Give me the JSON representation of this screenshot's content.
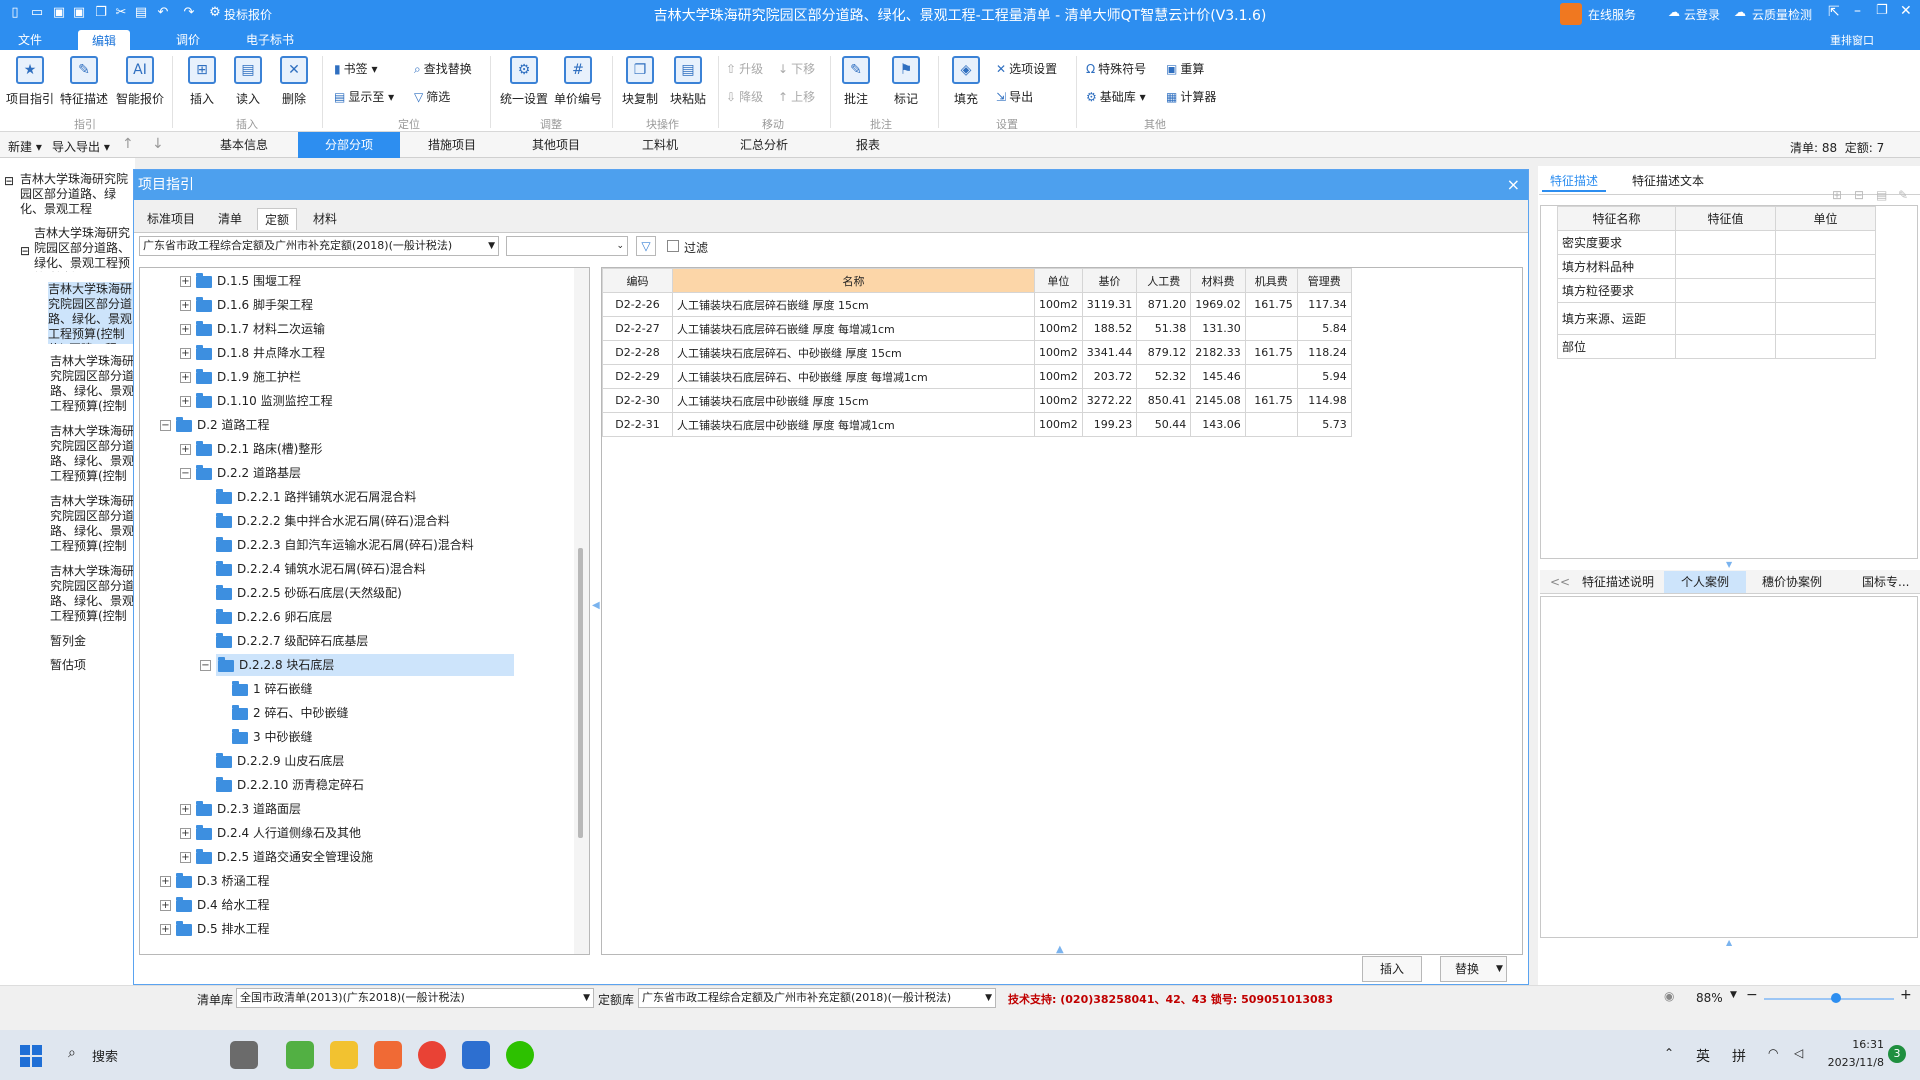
{
  "window": {
    "title": "吉林大学珠海研究院园区部分道路、绿化、景观工程-工程量清单 - 清单大师QT智慧云计价(V3.1.6)",
    "quick_bid": "投标报价",
    "online_service": "在线服务",
    "cloud_login": "云登录",
    "cloud_quality": "云质量检测",
    "rearrange_window": "重排窗口"
  },
  "menu": [
    "文件",
    "编辑",
    "调价",
    "电子标书"
  ],
  "menu_active": "编辑",
  "ribbon": {
    "big_buttons": [
      "项目指引",
      "特征描述",
      "智能报价",
      "插入",
      "读入",
      "删除",
      "统一设置",
      "单价编号",
      "块复制",
      "块粘贴",
      "批注",
      "标记",
      "填充"
    ],
    "small_buttons": {
      "bookmark": "书签",
      "show_to": "显示至",
      "find_replace": "查找替换",
      "filter": "筛选",
      "upgrade": "升级",
      "downgrade": "降级",
      "move_down": "下移",
      "move_up": "上移",
      "options": "选项设置",
      "export": "导出",
      "special_symbol": "特殊符号",
      "base_lib": "基础库",
      "recalc": "重算",
      "calculator": "计算器"
    },
    "groups": [
      "指引",
      "插入",
      "定位",
      "调整",
      "块操作",
      "移动",
      "批注",
      "设置",
      "其他"
    ]
  },
  "toolbar": {
    "new": "新建",
    "import_export": "导入导出",
    "page_tabs": [
      "基本信息",
      "分部分项",
      "措施项目",
      "其他项目",
      "工料机",
      "汇总分析",
      "报表"
    ],
    "active_tab": "分部分项",
    "count_qd_label": "清单:",
    "count_qd": "88",
    "count_de_label": "定额:",
    "count_de": "7"
  },
  "left_tree": [
    "吉林大学珠海研究院园区部分道路、绿化、景观工程",
    "吉林大学珠海研究院园区部分道路、绿化、景观工程预算(控制价)",
    "吉林大学珠海研究院园区部分道路、绿化、景观工程预算(控制价)-园建工程",
    "吉林大学珠海研究院园区部分道路、绿化、景观工程预算(控制价)-绿化工程",
    "吉林大学珠海研究院园区部分道路、绿化、景观工程预算(控制价)-给水工程",
    "吉林大学珠海研究院园区部分道路、绿化、景观工程预算(控制价)-排水工程",
    "吉林大学珠海研究院园区部分道路、绿化、景观工程预算(控制价)-照明工程",
    "暂列金",
    "暂估项"
  ],
  "dialog": {
    "title": "项目指引",
    "close": "×",
    "tabs": [
      "标准项目",
      "清单",
      "定额",
      "材料"
    ],
    "active_tab": "定额",
    "quota_lib": "广东省市政工程综合定额及广州市补充定额(2018)(一般计税法)",
    "filter_label": "过滤",
    "tree": [
      {
        "level": 1,
        "label": "D.1.5 围堰工程",
        "exp": "+"
      },
      {
        "level": 1,
        "label": "D.1.6 脚手架工程",
        "exp": "+"
      },
      {
        "level": 1,
        "label": "D.1.7 材料二次运输",
        "exp": "+"
      },
      {
        "level": 1,
        "label": "D.1.8 井点降水工程",
        "exp": "+"
      },
      {
        "level": 1,
        "label": "D.1.9 施工护栏",
        "exp": "+"
      },
      {
        "level": 1,
        "label": "D.1.10 监测监控工程",
        "exp": "+"
      },
      {
        "level": 0,
        "label": "D.2 道路工程",
        "exp": "−"
      },
      {
        "level": 1,
        "label": "D.2.1 路床(槽)整形",
        "exp": "+"
      },
      {
        "level": 1,
        "label": "D.2.2 道路基层",
        "exp": "−"
      },
      {
        "level": 2,
        "label": "D.2.2.1 路拌铺筑水泥石屑混合料",
        "exp": ""
      },
      {
        "level": 2,
        "label": "D.2.2.2 集中拌合水泥石屑(碎石)混合料",
        "exp": ""
      },
      {
        "level": 2,
        "label": "D.2.2.3 自卸汽车运输水泥石屑(碎石)混合料",
        "exp": ""
      },
      {
        "level": 2,
        "label": "D.2.2.4 铺筑水泥石屑(碎石)混合料",
        "exp": ""
      },
      {
        "level": 2,
        "label": "D.2.2.5 砂砾石底层(天然级配)",
        "exp": ""
      },
      {
        "level": 2,
        "label": "D.2.2.6 卵石底层",
        "exp": ""
      },
      {
        "level": 2,
        "label": "D.2.2.7 级配碎石底基层",
        "exp": ""
      },
      {
        "level": 2,
        "label": "D.2.2.8 块石底层",
        "exp": "−",
        "selected": true
      },
      {
        "level": 3,
        "label": "1 碎石嵌缝",
        "exp": ""
      },
      {
        "level": 3,
        "label": "2 碎石、中砂嵌缝",
        "exp": ""
      },
      {
        "level": 3,
        "label": "3 中砂嵌缝",
        "exp": ""
      },
      {
        "level": 2,
        "label": "D.2.2.9 山皮石底层",
        "exp": ""
      },
      {
        "level": 2,
        "label": "D.2.2.10 沥青稳定碎石",
        "exp": ""
      },
      {
        "level": 1,
        "label": "D.2.3 道路面层",
        "exp": "+"
      },
      {
        "level": 1,
        "label": "D.2.4 人行道侧缘石及其他",
        "exp": "+"
      },
      {
        "level": 1,
        "label": "D.2.5 道路交通安全管理设施",
        "exp": "+"
      },
      {
        "level": 0,
        "label": "D.3 桥涵工程",
        "exp": "+"
      },
      {
        "level": 0,
        "label": "D.4 给水工程",
        "exp": "+"
      },
      {
        "level": 0,
        "label": "D.5 排水工程",
        "exp": "+"
      }
    ],
    "columns": [
      "编码",
      "名称",
      "单位",
      "基价",
      "人工费",
      "材料费",
      "机具费",
      "管理费"
    ],
    "rows": [
      [
        "D2-2-26",
        "人工铺装块石底层碎石嵌缝 厚度 15cm",
        "100m2",
        "3119.31",
        "871.20",
        "1969.02",
        "161.75",
        "117.34"
      ],
      [
        "D2-2-27",
        "人工铺装块石底层碎石嵌缝 厚度 每增减1cm",
        "100m2",
        "188.52",
        "51.38",
        "131.30",
        "",
        "5.84"
      ],
      [
        "D2-2-28",
        "人工铺装块石底层碎石、中砂嵌缝 厚度 15cm",
        "100m2",
        "3341.44",
        "879.12",
        "2182.33",
        "161.75",
        "118.24"
      ],
      [
        "D2-2-29",
        "人工铺装块石底层碎石、中砂嵌缝 厚度 每增减1cm",
        "100m2",
        "203.72",
        "52.32",
        "145.46",
        "",
        "5.94"
      ],
      [
        "D2-2-30",
        "人工铺装块石底层中砂嵌缝 厚度 15cm",
        "100m2",
        "3272.22",
        "850.41",
        "2145.08",
        "161.75",
        "114.98"
      ],
      [
        "D2-2-31",
        "人工铺装块石底层中砂嵌缝 厚度 每增减1cm",
        "100m2",
        "199.23",
        "50.44",
        "143.06",
        "",
        "5.73"
      ]
    ],
    "insert": "插入",
    "replace": "替换"
  },
  "right_panel": {
    "tabs": [
      "特征描述",
      "特征描述文本"
    ],
    "columns": [
      "特征名称",
      "特征值",
      "单位"
    ],
    "features": [
      "密实度要求",
      "填方材料品种",
      "填方粒径要求",
      "填方来源、运距",
      "部位"
    ],
    "bottom_nav": "<<",
    "bottom_tabs": [
      "特征描述说明",
      "个人案例",
      "穗价协案例",
      "国标专..."
    ],
    "bottom_active": "个人案例"
  },
  "status": {
    "qd_lib_label": "清单库",
    "qd_lib": "全国市政清单(2013)(广东2018)(一般计税法)",
    "de_lib_label": "定额库",
    "de_lib": "广东省市政工程综合定额及广州市补充定额(2018)(一般计税法)",
    "support": "技术支持: (020)38258041、42、43 锁号: 509051013083",
    "zoom": "88%"
  },
  "taskbar": {
    "search": "搜索",
    "ime1": "英",
    "ime2": "拼",
    "time": "16:31",
    "date": "2023/11/8",
    "badge": "3"
  },
  "colors": {
    "accent": "#2d8ef0",
    "header_highlight": "#fcd6a8",
    "support_text": "#c00000"
  }
}
